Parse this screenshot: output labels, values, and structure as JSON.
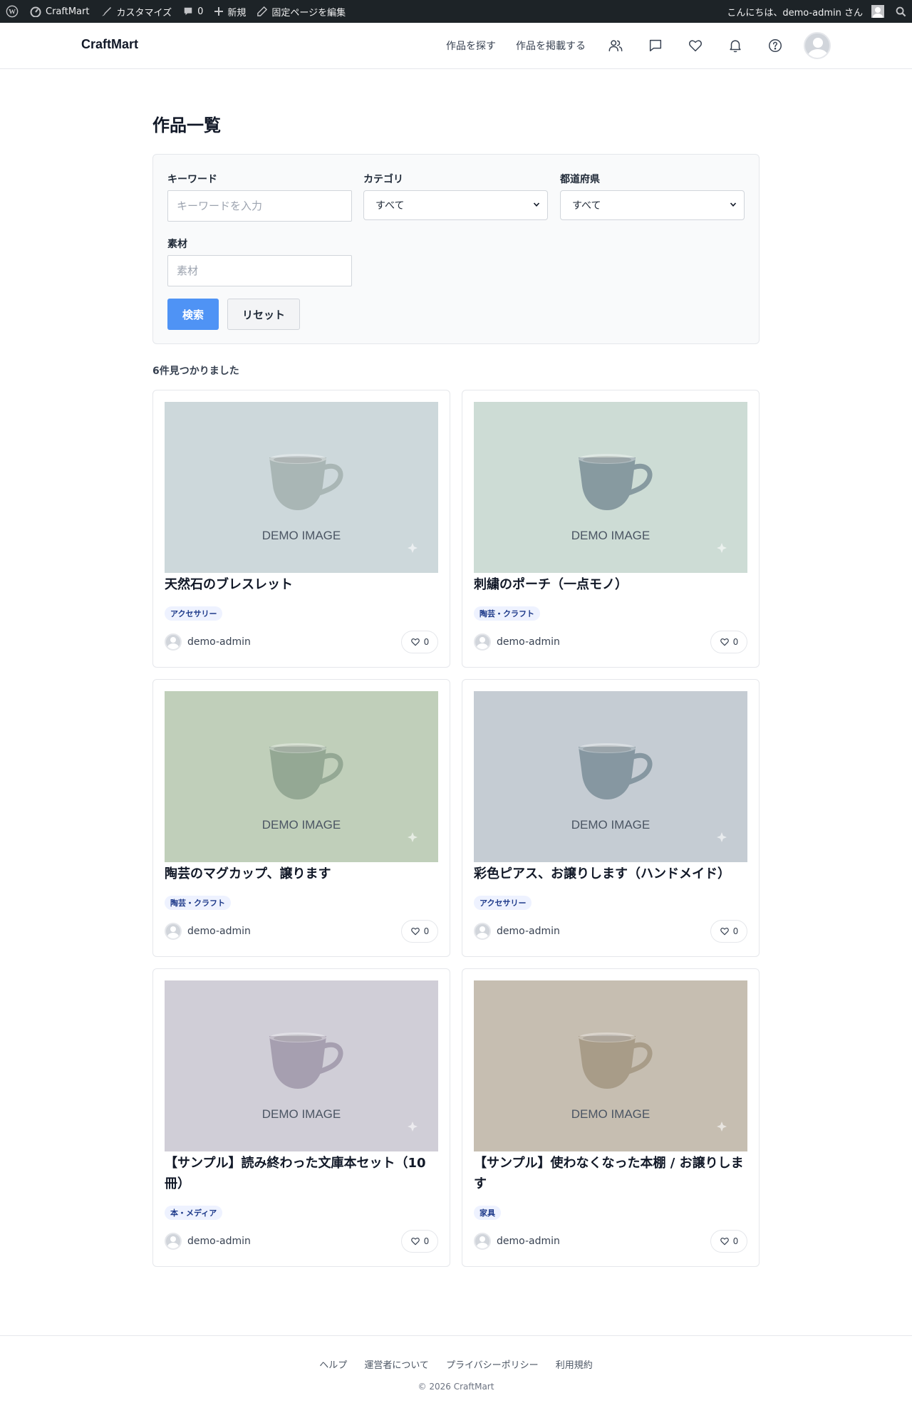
{
  "admin_bar": {
    "site_name": "CraftMart",
    "customize": "カスタマイズ",
    "comments_count": "0",
    "new": "新規",
    "edit_page": "固定ページを編集",
    "greeting": "こんにちは、demo-admin さん"
  },
  "header": {
    "logo": "CraftMart",
    "nav_find": "作品を探す",
    "nav_post": "作品を掲載する"
  },
  "page_title": "作品一覧",
  "search": {
    "keyword_label": "キーワード",
    "keyword_placeholder": "キーワードを入力",
    "category_label": "カテゴリ",
    "category_value": "すべて",
    "prefecture_label": "都道府県",
    "prefecture_value": "すべて",
    "material_label": "素材",
    "material_placeholder": "素材",
    "search_button": "検索",
    "reset_button": "リセット"
  },
  "results_count": "6件見つかりました",
  "cards": [
    {
      "title": "天然石のブレスレット",
      "category": "アクセサリー",
      "author": "demo-admin",
      "likes": "0",
      "image_text": "DEMO IMAGE",
      "bg": "#cdd8db",
      "cup": "#a9b6b5"
    },
    {
      "title": "刺繍のポーチ（一点モノ）",
      "category": "陶芸・クラフト",
      "author": "demo-admin",
      "likes": "0",
      "image_text": "DEMO IMAGE",
      "bg": "#cddcd5",
      "cup": "#879aa0"
    },
    {
      "title": "陶芸のマグカップ、譲ります",
      "category": "陶芸・クラフト",
      "author": "demo-admin",
      "likes": "0",
      "image_text": "DEMO IMAGE",
      "bg": "#c0cfba",
      "cup": "#94a894"
    },
    {
      "title": "彩色ピアス、お譲りします（ハンドメイド）",
      "category": "アクセサリー",
      "author": "demo-admin",
      "likes": "0",
      "image_text": "DEMO IMAGE",
      "bg": "#c5ccd3",
      "cup": "#8697a1"
    },
    {
      "title": "【サンプル】読み終わった文庫本セット（10冊）",
      "category": "本・メディア",
      "author": "demo-admin",
      "likes": "0",
      "image_text": "DEMO IMAGE",
      "bg": "#d0ced7",
      "cup": "#a69fb0"
    },
    {
      "title": "【サンプル】使わなくなった本棚 / お譲りします",
      "category": "家具",
      "author": "demo-admin",
      "likes": "0",
      "image_text": "DEMO IMAGE",
      "bg": "#c6beb1",
      "cup": "#a89c88"
    }
  ],
  "footer": {
    "help": "ヘルプ",
    "about": "運営者について",
    "privacy": "プライバシーポリシー",
    "terms": "利用規約",
    "copyright": "© 2026 CraftMart"
  }
}
